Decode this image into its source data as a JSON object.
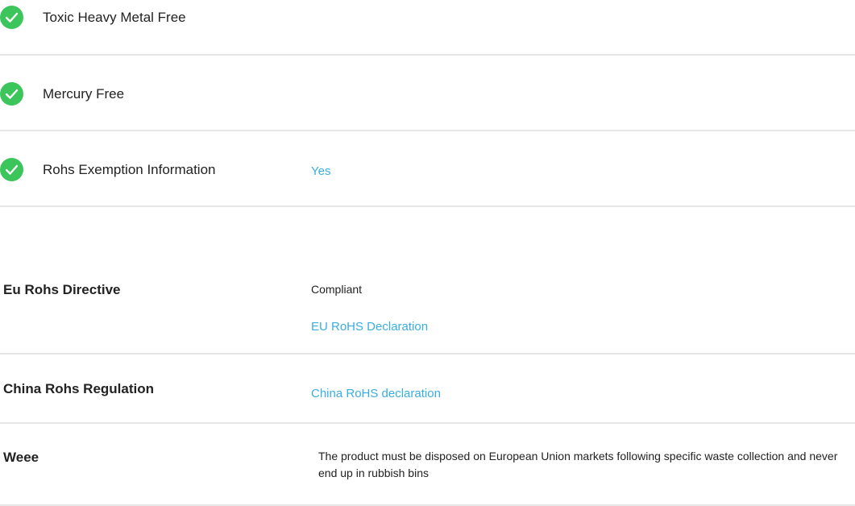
{
  "features": [
    {
      "label": "Toxic Heavy Metal Free",
      "value": "",
      "icon": "check-circle-icon"
    },
    {
      "label": "Mercury Free",
      "value": "",
      "icon": "check-circle-icon"
    },
    {
      "label": "Rohs Exemption Information",
      "value": "Yes",
      "icon": "check-circle-icon"
    }
  ],
  "regulations": [
    {
      "label": "Eu Rohs Directive",
      "status": "Compliant",
      "link": "EU RoHS Declaration"
    },
    {
      "label": "China Rohs Regulation",
      "link": "China RoHS declaration"
    },
    {
      "label": "Weee",
      "text": "The product must be disposed on European Union markets following specific waste collection and never end up in rubbish bins"
    }
  ],
  "colors": {
    "check": "#3cc55a",
    "link": "#3aaee0",
    "divider": "#e6e6e6"
  }
}
